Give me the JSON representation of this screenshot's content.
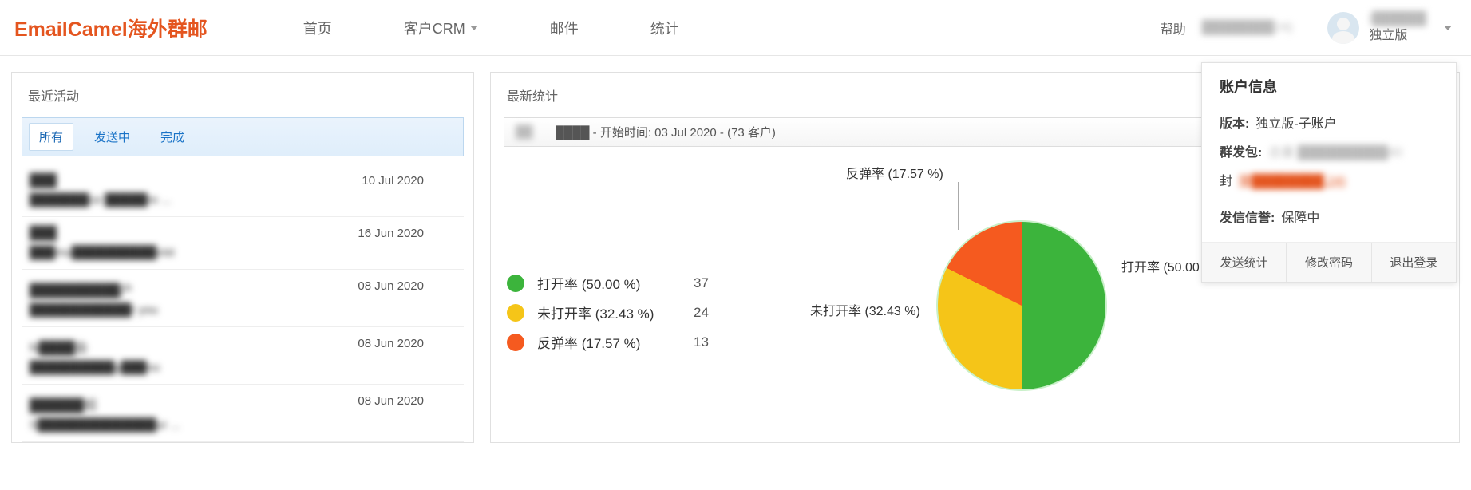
{
  "header": {
    "logo": "EmailCamel海外群邮",
    "nav": {
      "home": "首页",
      "crm": "客户CRM",
      "mail": "邮件",
      "stats": "统计"
    },
    "help": "帮助",
    "header_masked": "████████24)",
    "user": {
      "name_masked": "i██████",
      "plan": "独立版"
    }
  },
  "left_panel": {
    "title": "最近活动",
    "tabs": {
      "all": "所有",
      "sending": "发送中",
      "done": "完成"
    },
    "activities": [
      {
        "title_masked": "███",
        "sub_masked": "███████ce  █████re ...",
        "date": "10 Jul 2020"
      },
      {
        "title_masked": "███",
        "sub_masked": "███mu██████████vist",
        "date": "16 Jun 2020"
      },
      {
        "title_masked": "██████████户",
        "sub_masked": "████████████r you",
        "date": "08 Jun 2020"
      },
      {
        "title_masked": "N████会",
        "sub_masked": "██████████g███ou",
        "date": "08 Jun 2020"
      },
      {
        "title_masked": "██████绍",
        "sub_masked": "S██████████████ur ...",
        "date": "08 Jun 2020"
      }
    ]
  },
  "right_panel": {
    "title": "最新统计",
    "selector_masked": "████ - 开始时间: 03 Jul 2020 - (73 客户)",
    "legend": {
      "open": {
        "label": "打开率 (50.00 %)",
        "value": "37"
      },
      "unopen": {
        "label": "未打开率 (32.43 %)",
        "value": "24"
      },
      "bounce": {
        "label": "反弹率 (17.57 %)",
        "value": "13"
      }
    }
  },
  "popover": {
    "title": "账户信息",
    "version_label": "版本:",
    "version_value": "独立版-子账户",
    "quota_label": "群发包:",
    "quota_value_masked": "总量 ██████████40",
    "seal": "封",
    "seal_link_masked": "赠████████.24)",
    "reputation_label": "发信信誉:",
    "reputation_value": "保障中",
    "buttons": {
      "stats": "发送统计",
      "pwd": "修改密码",
      "logout": "退出登录"
    }
  },
  "chart_data": {
    "type": "pie",
    "title": "最新统计",
    "series": [
      {
        "name": "打开率",
        "percent": 50.0,
        "value": 37,
        "color": "#3cb43c"
      },
      {
        "name": "未打开率",
        "percent": 32.43,
        "value": 24,
        "color": "#f5c518"
      },
      {
        "name": "反弹率",
        "percent": 17.57,
        "value": 13,
        "color": "#f55a1f"
      }
    ]
  }
}
